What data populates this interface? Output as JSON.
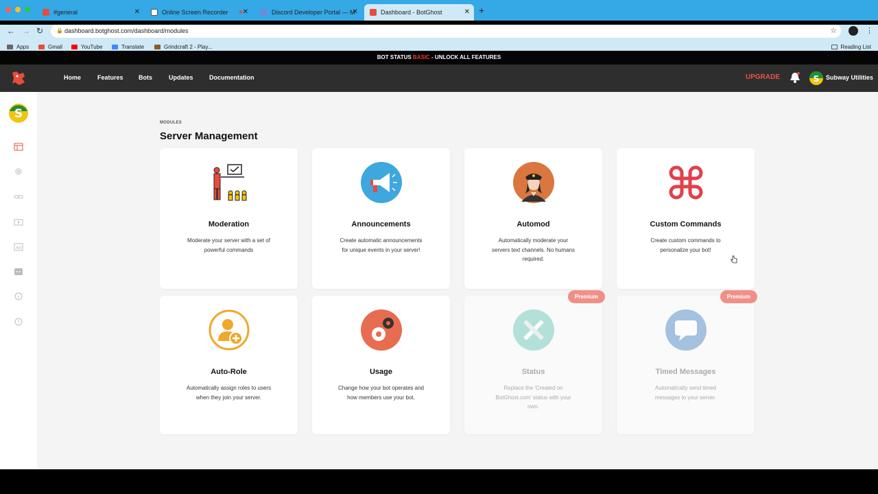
{
  "browser": {
    "tabs": [
      {
        "title": "#general",
        "favicon_color": "#e74c3c"
      },
      {
        "title": "Online Screen Recorder",
        "favicon_color": "#ffffff"
      },
      {
        "title": "Discord Developer Portal — M",
        "favicon_color": "#7289da"
      },
      {
        "title": "Dashboard - BotGhost",
        "favicon_color": "#e74c3c"
      }
    ],
    "new_tab": "+",
    "url": "dashboard.botghost.com/dashboard/modules",
    "bookmarks": [
      {
        "label": "Apps",
        "color": "#666666"
      },
      {
        "label": "Gmail",
        "color": "#e74c3c"
      },
      {
        "label": "YouTube",
        "color": "#ff0000"
      },
      {
        "label": "Translate",
        "color": "#4285f4"
      },
      {
        "label": "Grindcraft 2 - Play...",
        "color": "#8b5a2b"
      }
    ],
    "reading_list": "Reading List"
  },
  "status_bar": {
    "prefix": "BOT STATUS",
    "plan": "BASIC",
    "suffix": "- UNLOCK ALL FEATURES"
  },
  "nav": {
    "links": [
      "Home",
      "Features",
      "Bots",
      "Updates",
      "Documentation"
    ],
    "upgrade": "UPGRADE",
    "server_name": "Subway Utilities"
  },
  "page": {
    "breadcrumb": "MODULES",
    "title": "Server Management"
  },
  "modules": [
    {
      "name": "Moderation",
      "desc": "Moderate your server with a set of powerful commands",
      "icon": "moderation-icon",
      "premium": false
    },
    {
      "name": "Announcements",
      "desc": "Create automatic announcements for unique events in your server!",
      "icon": "megaphone-icon",
      "premium": false
    },
    {
      "name": "Automod",
      "desc": "Automatically moderate your servers text channels. No humans required.",
      "icon": "police-officer-icon",
      "premium": false
    },
    {
      "name": "Custom Commands",
      "desc": "Create custom commands to personalize your bot!",
      "icon": "command-key-icon",
      "premium": false
    },
    {
      "name": "Auto-Role",
      "desc": "Automatically assign roles to users when they join your server.",
      "icon": "add-user-icon",
      "premium": false
    },
    {
      "name": "Usage",
      "desc": "Change how your bot operates and how members use your bot.",
      "icon": "gears-icon",
      "premium": false
    },
    {
      "name": "Status",
      "desc": "Replace the 'Created on BotGhost.com' status with your own.",
      "icon": "tools-icon",
      "premium": true
    },
    {
      "name": "Timed Messages",
      "desc": "Automatically send timed messages to your server.",
      "icon": "chat-bubble-icon",
      "premium": true
    }
  ],
  "premium_label": "Premium",
  "colors": {
    "accent": "#e85545",
    "navbar": "#2e2e2e",
    "browser_chrome": "#35a8e6"
  }
}
